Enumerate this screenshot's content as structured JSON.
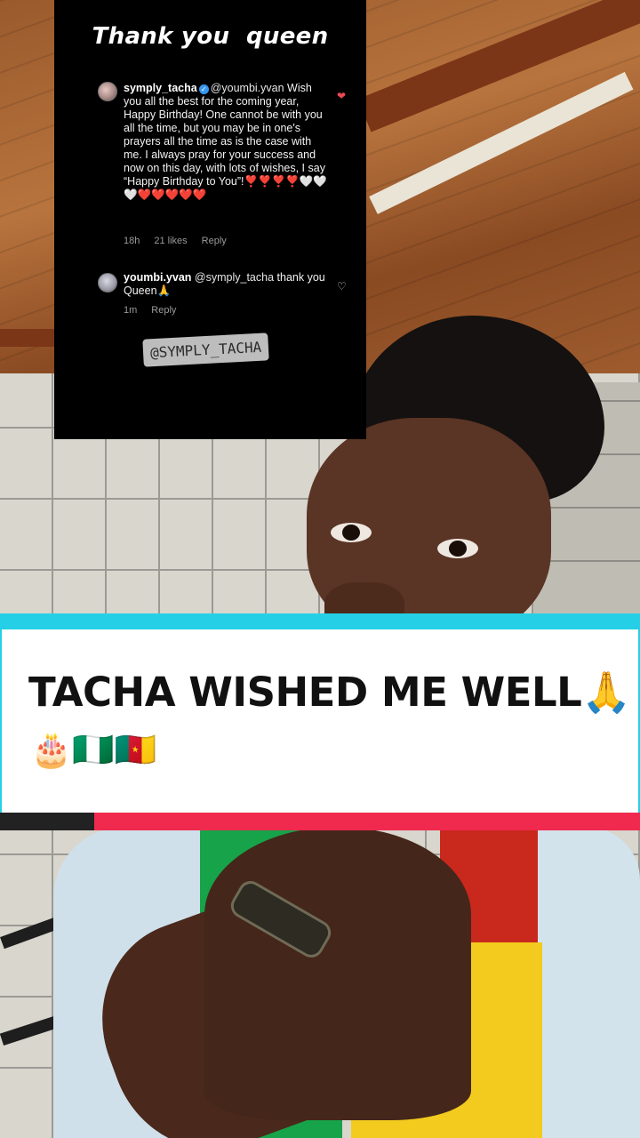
{
  "overlay": {
    "title": "Thank you  queen",
    "comments": [
      {
        "username": "symply_tacha",
        "verified_icon": "verified-badge-icon",
        "mention": "@youmbi.yvan",
        "text": "Wish you all the best for the coming year, Happy Birthday! One cannot be with you all the time, but you may be in one's prayers all the time as is the case with me. I always pray for your success and now on this day, with lots of wishes, I say “Happy Birthday to You”!",
        "hearts": "❣️❣️❣️❣️🤍🤍🤍❤️❤️❤️❤️❤️",
        "time": "18h",
        "likes": "21 likes",
        "reply": "Reply",
        "like_icon": "heart-filled-icon",
        "like_color": "#ed4956"
      },
      {
        "username": "youmbi.yvan",
        "mention": "@symply_tacha",
        "text": "thank you Queen🙏",
        "time": "1m",
        "reply": "Reply",
        "like_icon": "heart-outline-icon"
      }
    ],
    "handle_sticker": "@SYMPLY_TACHA"
  },
  "caption": {
    "headline": "TACHA WISHED ME WELL🙏",
    "emoji_line": "🎂🇳🇬🇨🇲",
    "accent_colors": {
      "cyan": "#25d0e6",
      "red": "#f0294e"
    }
  }
}
